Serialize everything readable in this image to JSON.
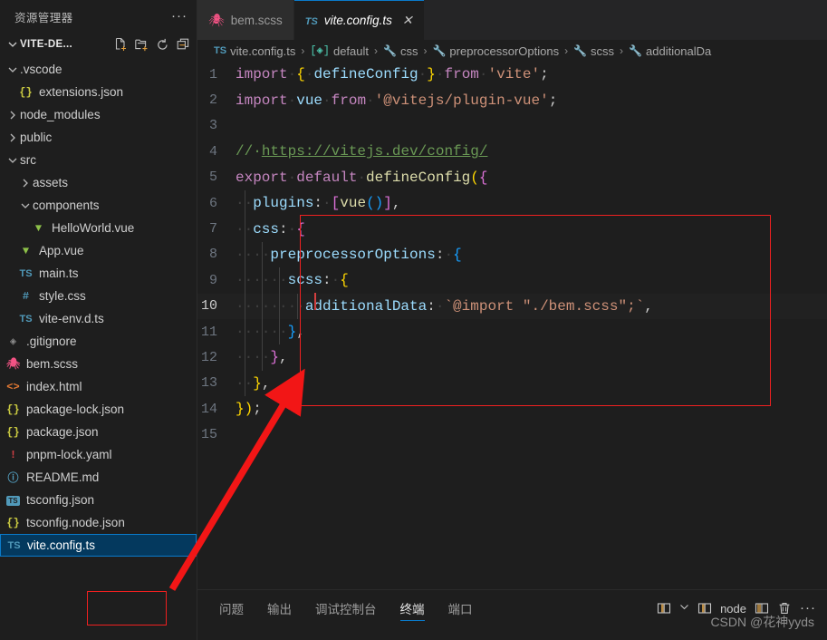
{
  "sidebar": {
    "title": "资源管理器",
    "more_label": "···",
    "root": {
      "label": "VITE-DE...",
      "expanded": true,
      "actions": [
        {
          "name": "new-file-icon",
          "tooltip": "新建文件"
        },
        {
          "name": "new-folder-icon",
          "tooltip": "新建文件夹"
        },
        {
          "name": "refresh-icon",
          "tooltip": "在资源管理器中刷新"
        },
        {
          "name": "collapse-all-icon",
          "tooltip": "在资源管理器中折叠文件夹"
        }
      ]
    },
    "items": [
      {
        "label": ".vscode",
        "type": "folder",
        "state": "expanded",
        "indent": 1,
        "icon": "chevron-down-icon"
      },
      {
        "label": "extensions.json",
        "type": "file",
        "kind": "json",
        "indent": 2,
        "icon": "json-icon"
      },
      {
        "label": "node_modules",
        "type": "folder",
        "state": "collapsed",
        "indent": 1,
        "icon": "chevron-right-icon"
      },
      {
        "label": "public",
        "type": "folder",
        "state": "collapsed",
        "indent": 1,
        "icon": "chevron-right-icon"
      },
      {
        "label": "src",
        "type": "folder",
        "state": "expanded",
        "indent": 1,
        "icon": "chevron-down-icon"
      },
      {
        "label": "assets",
        "type": "folder",
        "state": "collapsed",
        "indent": 2,
        "icon": "chevron-right-icon"
      },
      {
        "label": "components",
        "type": "folder",
        "state": "expanded",
        "indent": 2,
        "icon": "chevron-down-icon"
      },
      {
        "label": "HelloWorld.vue",
        "type": "file",
        "kind": "vue",
        "indent": 3,
        "icon": "vue-icon"
      },
      {
        "label": "App.vue",
        "type": "file",
        "kind": "vue",
        "indent": 2,
        "icon": "vue-icon"
      },
      {
        "label": "main.ts",
        "type": "file",
        "kind": "ts",
        "indent": 2,
        "icon": "ts-icon"
      },
      {
        "label": "style.css",
        "type": "file",
        "kind": "css",
        "indent": 2,
        "icon": "css-icon"
      },
      {
        "label": "vite-env.d.ts",
        "type": "file",
        "kind": "ts",
        "indent": 2,
        "icon": "ts-icon"
      },
      {
        "label": ".gitignore",
        "type": "file",
        "kind": "git",
        "indent": 1,
        "icon": "git-icon"
      },
      {
        "label": "bem.scss",
        "type": "file",
        "kind": "scss",
        "indent": 1,
        "icon": "sass-icon"
      },
      {
        "label": "index.html",
        "type": "file",
        "kind": "html",
        "indent": 1,
        "icon": "html-icon"
      },
      {
        "label": "package-lock.json",
        "type": "file",
        "kind": "json",
        "indent": 1,
        "icon": "json-icon"
      },
      {
        "label": "package.json",
        "type": "file",
        "kind": "json",
        "indent": 1,
        "icon": "json-icon"
      },
      {
        "label": "pnpm-lock.yaml",
        "type": "file",
        "kind": "yaml",
        "indent": 1,
        "icon": "yaml-icon"
      },
      {
        "label": "README.md",
        "type": "file",
        "kind": "md",
        "indent": 1,
        "icon": "info-icon"
      },
      {
        "label": "tsconfig.json",
        "type": "file",
        "kind": "tsconfig",
        "indent": 1,
        "icon": "tsconfig-icon"
      },
      {
        "label": "tsconfig.node.json",
        "type": "file",
        "kind": "json",
        "indent": 1,
        "icon": "json-icon"
      },
      {
        "label": "vite.config.ts",
        "type": "file",
        "kind": "ts",
        "indent": 1,
        "icon": "ts-icon",
        "selected": true
      }
    ]
  },
  "tabs": [
    {
      "label": "bem.scss",
      "icon": "sass-icon",
      "active": false,
      "close_label": ""
    },
    {
      "label": "vite.config.ts",
      "icon": "ts-icon",
      "active": true,
      "close_label": "✕"
    }
  ],
  "breadcrumb": [
    {
      "label": "vite.config.ts",
      "icon": "ts-icon"
    },
    {
      "label": "default",
      "icon": "module-icon"
    },
    {
      "label": "css",
      "icon": "property-icon"
    },
    {
      "label": "preprocessorOptions",
      "icon": "property-icon"
    },
    {
      "label": "scss",
      "icon": "property-icon"
    },
    {
      "label": "additionalDa",
      "icon": "property-icon"
    }
  ],
  "breadcrumb_separator": "›",
  "editor": {
    "language": "TypeScript",
    "active_line": 10,
    "lines": [
      {
        "n": 1,
        "text": "import { defineConfig } from 'vite';"
      },
      {
        "n": 2,
        "text": "import vue from '@vitejs/plugin-vue';"
      },
      {
        "n": 3,
        "text": ""
      },
      {
        "n": 4,
        "text": "// https://vitejs.dev/config/"
      },
      {
        "n": 5,
        "text": "export default defineConfig({"
      },
      {
        "n": 6,
        "text": "  plugins: [vue()],"
      },
      {
        "n": 7,
        "text": "  css: {"
      },
      {
        "n": 8,
        "text": "    preprocessorOptions: {"
      },
      {
        "n": 9,
        "text": "      scss: {"
      },
      {
        "n": 10,
        "text": "        additionalData: `@import \"./bem.scss\";`,"
      },
      {
        "n": 11,
        "text": "      },"
      },
      {
        "n": 12,
        "text": "    },"
      },
      {
        "n": 13,
        "text": "  },"
      },
      {
        "n": 14,
        "text": "});"
      },
      {
        "n": 15,
        "text": ""
      }
    ]
  },
  "annotations": {
    "rect_color": "#ef2020",
    "arrow_color": "#f21616",
    "rect_target": "css block lines 7-13",
    "arrow_from": "vite.config.ts in explorer",
    "arrow_to": "line 13 closing brace"
  },
  "panel": {
    "tabs": [
      {
        "label": "问题",
        "active": false
      },
      {
        "label": "输出",
        "active": false
      },
      {
        "label": "调试控制台",
        "active": false
      },
      {
        "label": "终端",
        "active": true
      },
      {
        "label": "端口",
        "active": false
      }
    ],
    "actions": [
      {
        "name": "split-terminal-icon",
        "label": ""
      },
      {
        "name": "chevron-down-icon",
        "label": "⌄"
      },
      {
        "name": "terminal-node-icon",
        "label": "node"
      },
      {
        "name": "split-editor-icon",
        "label": ""
      },
      {
        "name": "trash-icon",
        "label": ""
      },
      {
        "name": "more-actions-icon",
        "label": "···"
      }
    ],
    "node_label": "node"
  },
  "watermark": "CSDN @花神yyds",
  "colors": {
    "accent": "#0a7aca",
    "selection_bg": "#04395e",
    "editor_bg": "#1e1e1e",
    "tabs_bg": "#252526",
    "annotation_red": "#ef2020"
  }
}
